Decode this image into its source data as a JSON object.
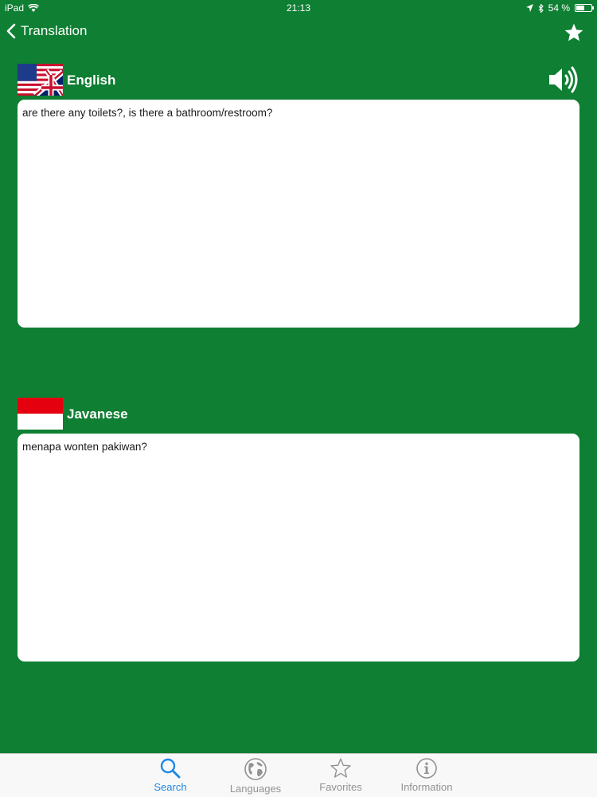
{
  "status_bar": {
    "device": "iPad",
    "time": "21:13",
    "battery_text": "54 %",
    "battery_level": 0.54
  },
  "nav": {
    "back_label": "Translation",
    "back_icon": "chevron-left-icon",
    "favorite_icon": "star-icon"
  },
  "source": {
    "language": "English",
    "flag_icon": "us-uk-flag-icon",
    "text": "are there any toilets?, is there a bathroom/restroom?",
    "speaker_icon": "speaker-icon"
  },
  "target": {
    "language": "Javanese",
    "flag_icon": "indonesia-flag-icon",
    "text": "menapa wonten pakiwan?"
  },
  "tabs": [
    {
      "label": "Search",
      "icon": "search-icon",
      "active": true
    },
    {
      "label": "Languages",
      "icon": "globe-icon",
      "active": false
    },
    {
      "label": "Favorites",
      "icon": "star-outline-icon",
      "active": false
    },
    {
      "label": "Information",
      "icon": "info-icon",
      "active": false
    }
  ],
  "colors": {
    "background": "#0f7f33",
    "tab_active": "#1e88e5",
    "tab_inactive": "#929292"
  }
}
